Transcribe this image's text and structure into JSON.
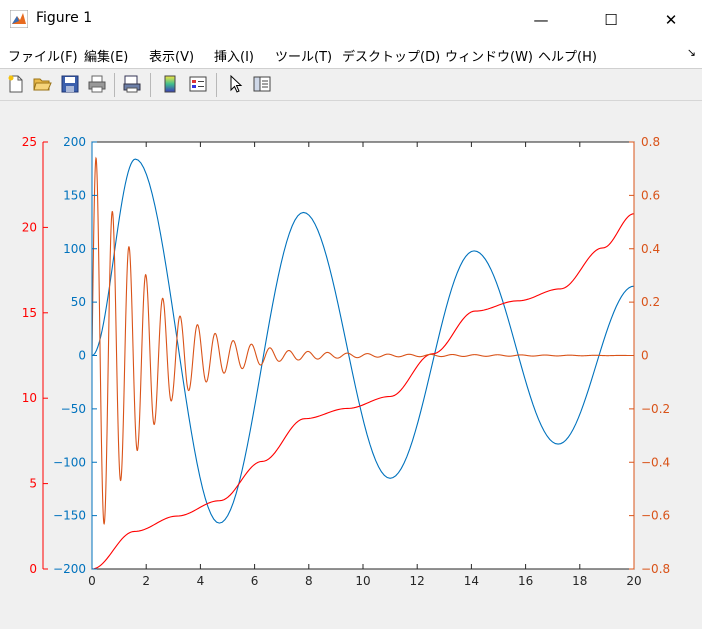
{
  "window": {
    "title": "Figure 1",
    "minimize": "—",
    "maximize": "☐",
    "close": "✕"
  },
  "menu": [
    "ファイル(F)",
    "編集(E)",
    "表示(V)",
    "挿入(I)",
    "ツール(T)",
    "デスクトップ(D)",
    "ウィンドウ(W)",
    "ヘルプ(H)"
  ],
  "menu_overflow": "↘",
  "toolbar": [
    "new-file-icon",
    "open-folder-icon",
    "save-icon",
    "print-icon",
    "print-preview-icon",
    "colorbar-icon",
    "legend-icon",
    "pointer-icon",
    "property-editor-icon"
  ],
  "chart_data": {
    "type": "line",
    "x_ticks": [
      0,
      2,
      4,
      6,
      8,
      10,
      12,
      14,
      16,
      18,
      20
    ],
    "xlim": [
      0,
      20
    ],
    "axes": {
      "inner_left": {
        "color": "#0072BD",
        "ylim": [
          -200,
          200
        ],
        "ticks": [
          -200,
          -150,
          -100,
          -50,
          0,
          50,
          100,
          150,
          200
        ]
      },
      "outer_left": {
        "color": "#FF0000",
        "ylim": [
          0,
          25
        ],
        "ticks": [
          0,
          5,
          10,
          15,
          20,
          25
        ]
      },
      "right": {
        "color": "#D95319",
        "ylim": [
          -0.8,
          0.8
        ],
        "ticks": [
          -0.8,
          -0.6,
          -0.4,
          -0.2,
          0,
          0.2,
          0.4,
          0.6,
          0.8
        ]
      }
    },
    "series": [
      {
        "axis": "inner_left",
        "color": "#0072BD",
        "x": [
          0,
          1.6,
          4.7,
          7.8,
          11,
          14.1,
          17.2,
          20
        ],
        "y": [
          0,
          184,
          -157,
          134,
          -115,
          98,
          -83,
          65
        ]
      },
      {
        "axis": "outer_left",
        "color": "#FF0000",
        "x": [
          0,
          1.57,
          3.14,
          4.71,
          6.28,
          7.85,
          9.42,
          11,
          12.57,
          14.14,
          15.71,
          17.28,
          18.85,
          20
        ],
        "y": [
          0,
          2.2,
          3.1,
          4.0,
          6.3,
          8.8,
          9.4,
          10.1,
          12.6,
          15.1,
          15.7,
          16.4,
          18.8,
          20.8
        ]
      },
      {
        "axis": "right",
        "color": "#D95319",
        "type": "damped oscillation",
        "x": [
          0,
          0.15,
          0.45,
          0.75,
          1.05,
          1.35,
          1.65,
          2.0,
          3.0,
          5.0,
          7.0,
          9.0,
          11.0,
          20
        ],
        "y": [
          0,
          0.74,
          -0.63,
          0.54,
          -0.47,
          0.41,
          -0.36,
          0.3,
          0.16,
          0.06,
          0.02,
          0.01,
          0.005,
          0
        ]
      }
    ]
  }
}
